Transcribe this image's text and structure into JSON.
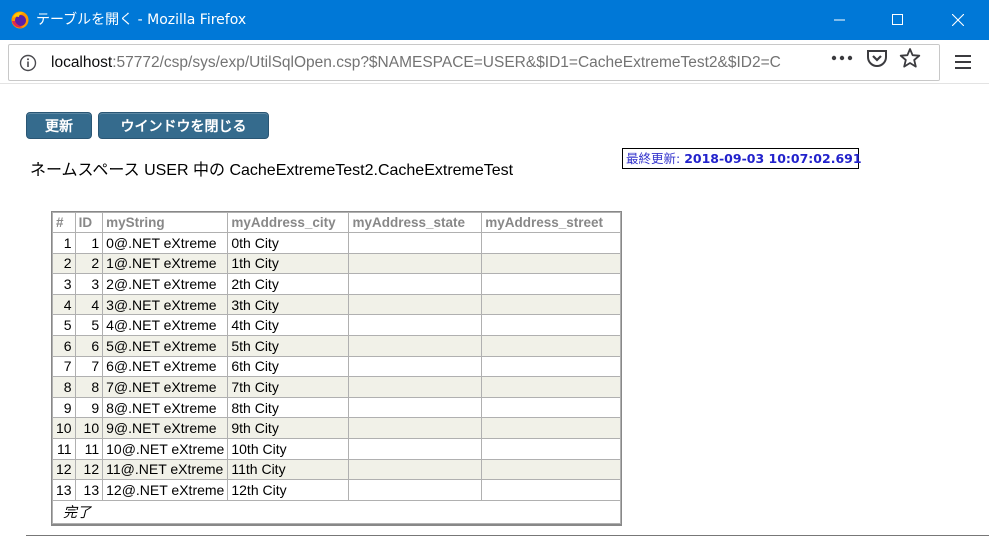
{
  "window": {
    "title": "テーブルを開く - Mozilla Firefox"
  },
  "urlbar": {
    "host": "localhost",
    "rest": ":57772/csp/sys/exp/UtilSqlOpen.csp?$NAMESPACE=USER&$ID1=CacheExtremeTest2&$ID2=C"
  },
  "toolbar": {
    "refresh_label": "更新",
    "close_window_label": "ウインドウを閉じる"
  },
  "caption": {
    "prefix": "ネームスペース",
    "namespace": "USER",
    "middle": "中の",
    "table_name": "CacheExtremeTest2.CacheExtremeTest"
  },
  "last_update": {
    "label": "最終更新:",
    "value": "2018-09-03 10:07:02.691"
  },
  "table": {
    "headers": [
      "#",
      "ID",
      "myString",
      "myAddress_city",
      "myAddress_state",
      "myAddress_street"
    ],
    "rows": [
      [
        "1",
        "1",
        "0@.NET eXtreme",
        "0th City",
        "",
        ""
      ],
      [
        "2",
        "2",
        "1@.NET eXtreme",
        "1th City",
        "",
        ""
      ],
      [
        "3",
        "3",
        "2@.NET eXtreme",
        "2th City",
        "",
        ""
      ],
      [
        "4",
        "4",
        "3@.NET eXtreme",
        "3th City",
        "",
        ""
      ],
      [
        "5",
        "5",
        "4@.NET eXtreme",
        "4th City",
        "",
        ""
      ],
      [
        "6",
        "6",
        "5@.NET eXtreme",
        "5th City",
        "",
        ""
      ],
      [
        "7",
        "7",
        "6@.NET eXtreme",
        "6th City",
        "",
        ""
      ],
      [
        "8",
        "8",
        "7@.NET eXtreme",
        "7th City",
        "",
        ""
      ],
      [
        "9",
        "9",
        "8@.NET eXtreme",
        "8th City",
        "",
        ""
      ],
      [
        "10",
        "10",
        "9@.NET eXtreme",
        "9th City",
        "",
        ""
      ],
      [
        "11",
        "11",
        "10@.NET eXtreme",
        "10th City",
        "",
        ""
      ],
      [
        "12",
        "12",
        "11@.NET eXtreme",
        "11th City",
        "",
        ""
      ],
      [
        "13",
        "13",
        "12@.NET eXtreme",
        "12th City",
        "",
        ""
      ]
    ],
    "footer": "完了"
  },
  "colors": {
    "titlebar": "#0078d7",
    "button": "#356b8d",
    "even_row": "#f1f1e8",
    "last_update_text": "#2222cc"
  },
  "icons": {
    "app": "firefox-logo-icon",
    "info": "info-icon",
    "more": "more-dots-icon",
    "pocket": "pocket-icon",
    "bookmark": "star-icon",
    "menu": "hamburger-menu-icon"
  }
}
